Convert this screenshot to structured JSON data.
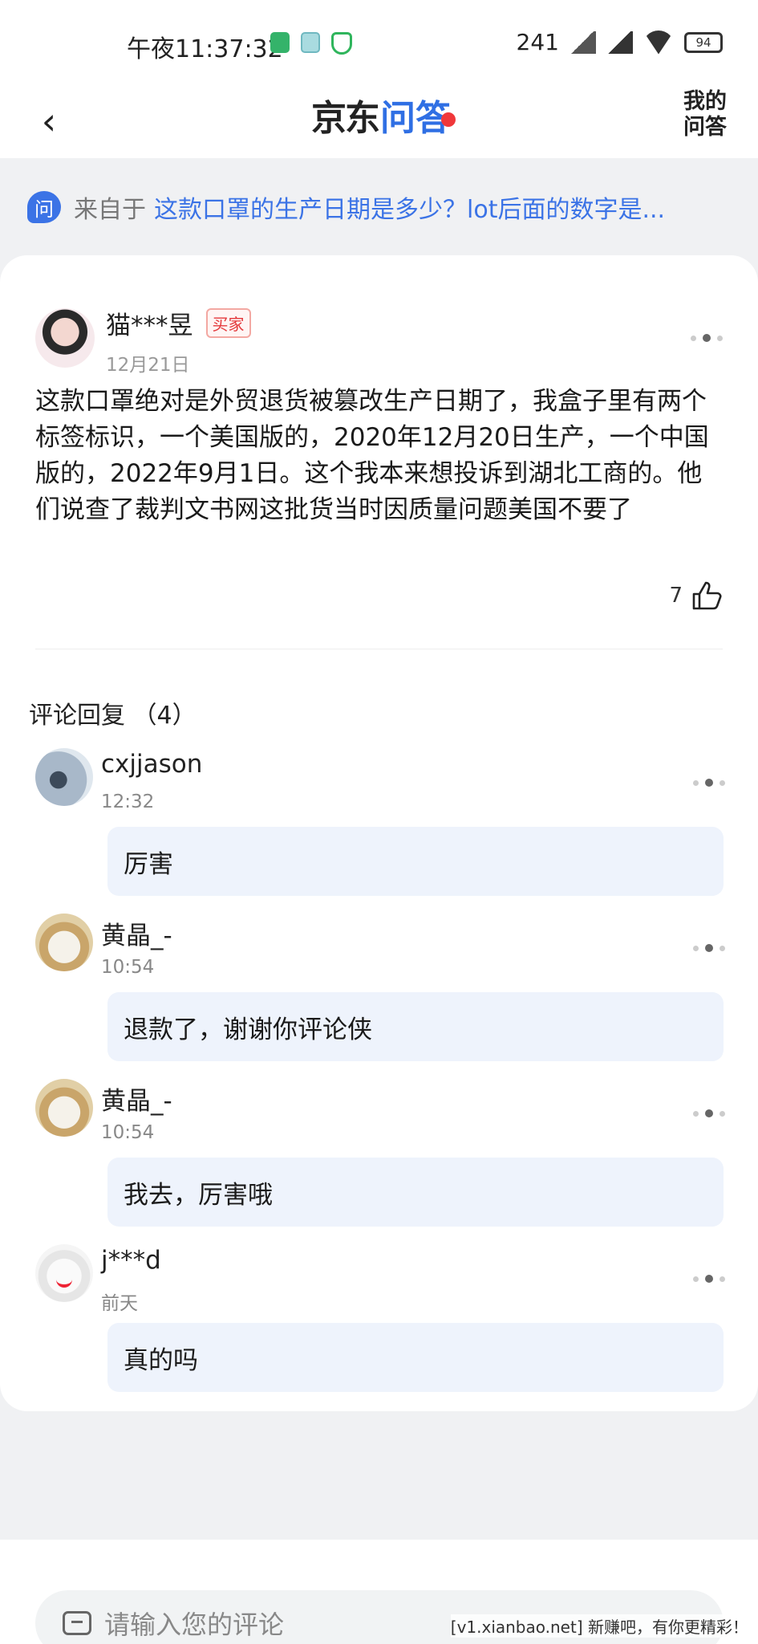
{
  "status_bar": {
    "time": "午夜11:37:32",
    "speed": "241",
    "battery": "94"
  },
  "nav": {
    "back_icon": "‹",
    "logo_jd": "京东",
    "logo_wenda": "问答",
    "my_qa": "我的问答"
  },
  "source": {
    "icon_label": "问",
    "prefix": "来自于",
    "question": "这款口罩的生产日期是多少？lot后面的数字是..."
  },
  "answer": {
    "user": "猫***昱",
    "tag": "买家",
    "date": "12月21日",
    "text": "这款口罩绝对是外贸退货被篡改生产日期了，我盒子里有两个标签标识，一个美国版的，2020年12月20日生产，一个中国版的，2022年9月1日。这个我本来想投诉到湖北工商的。他们说查了裁判文书网这批货当时因质量问题美国不要了",
    "likes": "7"
  },
  "comments_title": "评论回复 （4）",
  "comments": [
    {
      "user": "cxjjason",
      "time": "12:32",
      "text": "厉害"
    },
    {
      "user": "黄晶_-",
      "time": "10:54",
      "text": "退款了，谢谢你评论侠"
    },
    {
      "user": "黄晶_-",
      "time": "10:54",
      "text": "我去，厉害哦"
    },
    {
      "user": "j***d",
      "time": "前天",
      "text": "真的吗"
    }
  ],
  "input": {
    "placeholder": "请输入您的评论"
  },
  "watermark": "[v1.xianbao.net] 新赚吧，有你更精彩！",
  "colors": {
    "accent": "#3b73e6",
    "buyer_tag": "#e4393c",
    "bubble": "#eef3fc"
  }
}
